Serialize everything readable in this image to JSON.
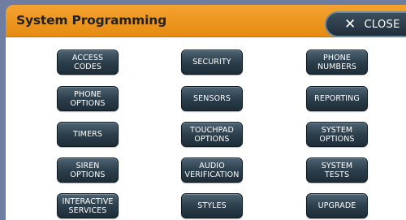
{
  "header": {
    "title": "System Programming",
    "close_label": "CLOSE",
    "accent_color": "#e8900f"
  },
  "buttons": {
    "access_codes": "ACCESS\nCODES",
    "security": "SECURITY",
    "phone_numbers": "PHONE\nNUMBERS",
    "phone_options": "PHONE\nOPTIONS",
    "sensors": "SENSORS",
    "reporting": "REPORTING",
    "timers": "TIMERS",
    "touchpad_options": "TOUCHPAD\nOPTIONS",
    "system_options": "SYSTEM\nOPTIONS",
    "siren_options": "SIREN\nOPTIONS",
    "audio_verification": "AUDIO\nVERIFICATION",
    "system_tests": "SYSTEM\nTESTS",
    "interactive_services": "INTERACTIVE\nSERVICES",
    "styles": "STYLES",
    "upgrade": "UPGRADE"
  }
}
